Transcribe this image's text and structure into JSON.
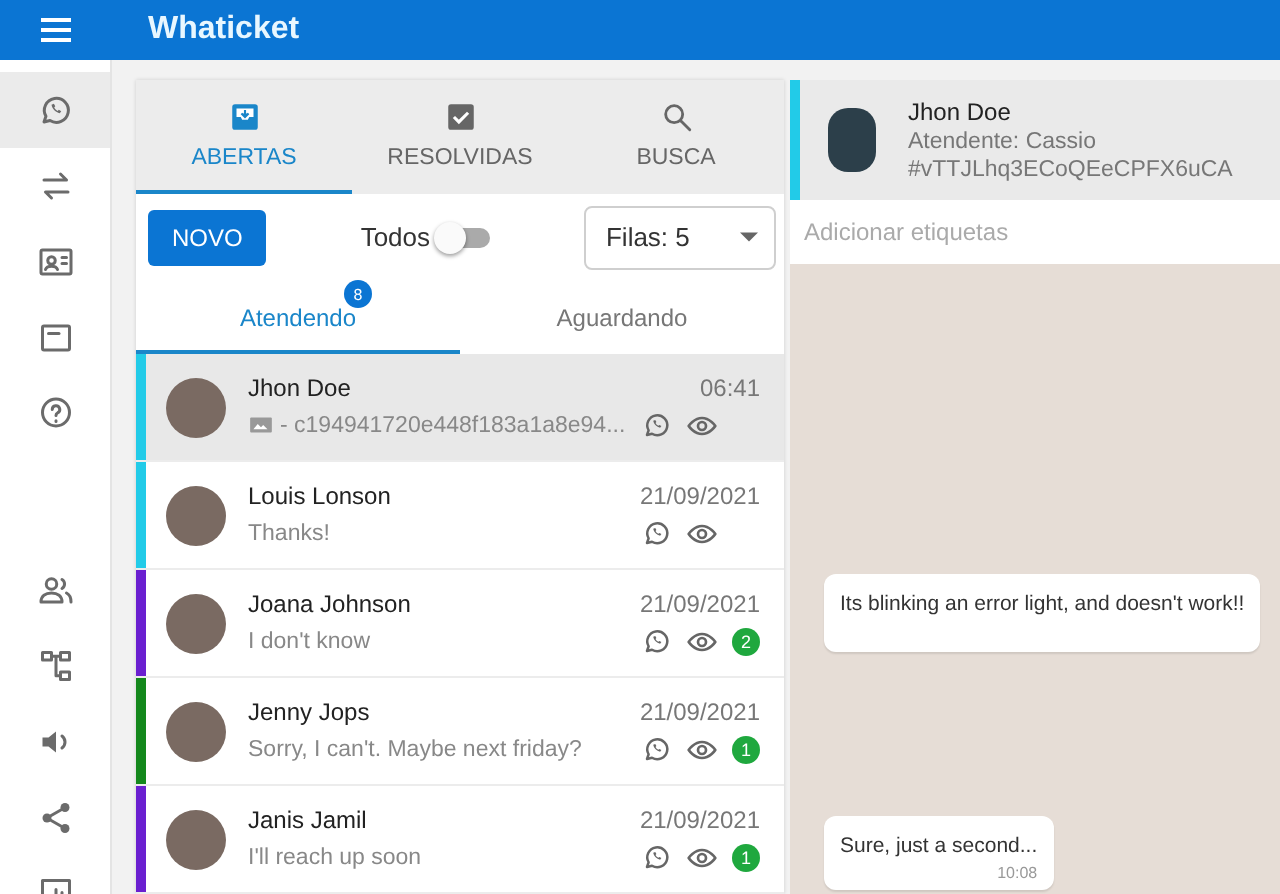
{
  "app_bar": {
    "title": "Whaticket"
  },
  "sidebar": {
    "main_items": [
      {
        "selected": true
      },
      {
        "selected": false
      },
      {
        "selected": false
      },
      {
        "selected": false
      },
      {
        "selected": false
      }
    ],
    "admin_items": [
      {
        "selected": false
      },
      {
        "selected": false
      },
      {
        "selected": false
      },
      {
        "selected": false
      },
      {
        "selected": false
      }
    ]
  },
  "tickets": {
    "tabs": [
      {
        "label": "ABERTAS",
        "selected": true
      },
      {
        "label": "RESOLVIDAS",
        "selected": false
      },
      {
        "label": "BUSCA",
        "selected": false
      }
    ],
    "new_button": "NOVO",
    "show_all": {
      "label": "Todos",
      "on": false
    },
    "queue_select": {
      "value": "Filas: 5"
    },
    "sub_tabs": [
      {
        "label": "Atendendo",
        "selected": true,
        "badge": "8"
      },
      {
        "label": "Aguardando",
        "selected": false
      }
    ],
    "rows": [
      {
        "name": "Jhon Doe",
        "time": "06:41",
        "message": "- c194941720e448f183a1a8e94...",
        "media": true,
        "color": "#22cbe8",
        "selected": true
      },
      {
        "name": "Louis Lonson",
        "time": "21/09/2021",
        "message": "Thanks!",
        "media": false,
        "color": "#22cbe8",
        "selected": false
      },
      {
        "name": "Joana Johnson",
        "time": "21/09/2021",
        "message": "I don't know",
        "media": false,
        "unread": "2",
        "color": "#6a1fd0",
        "selected": false
      },
      {
        "name": "Jenny Jops",
        "time": "21/09/2021",
        "message": "Sorry, I can't. Maybe next friday?",
        "media": false,
        "unread": "1",
        "color": "#14881c",
        "selected": false
      },
      {
        "name": "Janis Jamil",
        "time": "21/09/2021",
        "message": "I'll reach up soon",
        "media": false,
        "unread": "1",
        "color": "#6a1fd0",
        "selected": false
      }
    ]
  },
  "chat": {
    "header": {
      "name": "Jhon Doe",
      "attendant": "Atendente: Cassio",
      "ticket_id": "#vTTJLhq3ECoQEeCPFX6uCA",
      "color": "#22cbe8"
    },
    "tags": {
      "placeholder": "Adicionar etiquetas"
    },
    "messages": [
      {
        "text": "Its blinking an error light, and doesn't work!!"
      },
      {
        "text": "Sure, just a second...",
        "time": "10:08"
      }
    ]
  }
}
